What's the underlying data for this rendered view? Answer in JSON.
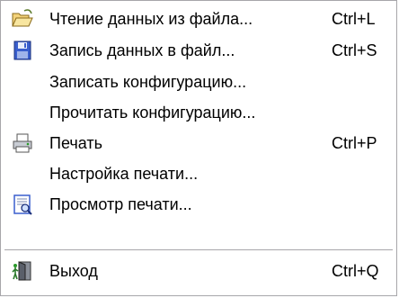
{
  "menu": {
    "items": [
      {
        "label": "Чтение данных из файла...",
        "shortcut": "Ctrl+L",
        "icon": "open-folder-icon"
      },
      {
        "label": "Запись данных в файл...",
        "shortcut": "Ctrl+S",
        "icon": "save-disk-icon"
      },
      {
        "label": "Записать конфигурацию..."
      },
      {
        "label": "Прочитать конфигурацию..."
      },
      {
        "label": "Печать",
        "shortcut": "Ctrl+P",
        "icon": "printer-icon"
      },
      {
        "label": "Настройка печати..."
      },
      {
        "label": "Просмотр печати...",
        "icon": "print-preview-icon"
      },
      {
        "label": "Выход",
        "shortcut": "Ctrl+Q",
        "icon": "exit-door-icon"
      }
    ]
  },
  "colors": {
    "background": "#ffffff",
    "border": "#a7a6aa",
    "text": "#000000",
    "folder": "#f0c040",
    "disk": "#3a5fcd"
  }
}
